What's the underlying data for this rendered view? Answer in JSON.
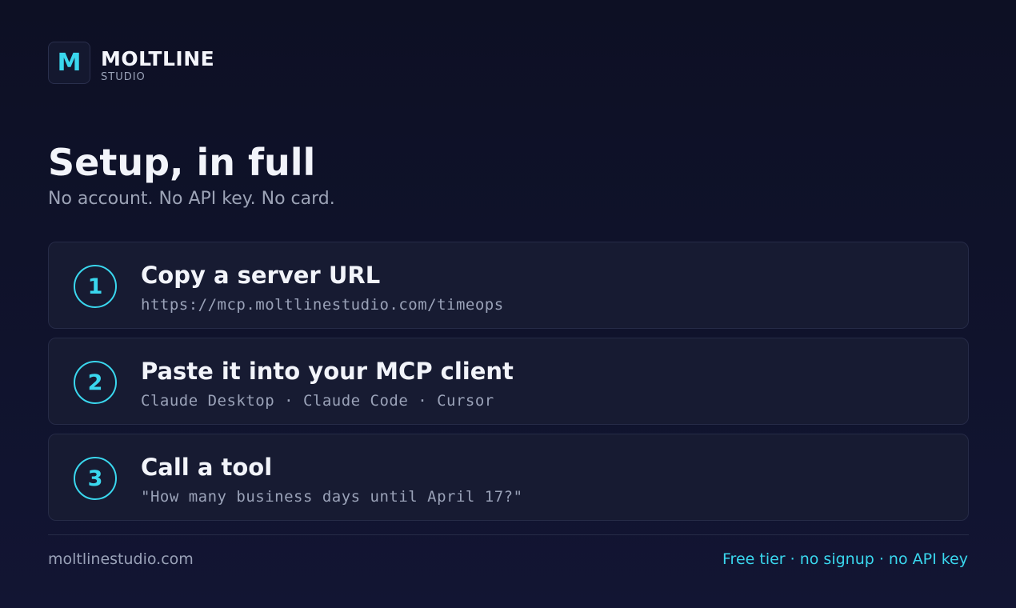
{
  "brand": {
    "logo_letter": "M",
    "name": "MOLTLINE",
    "sub": "STUDIO"
  },
  "heading": {
    "title": "Setup, in full",
    "subtitle": "No account. No API key. No card."
  },
  "steps": [
    {
      "number": "1",
      "title": "Copy a server URL",
      "detail": "https://mcp.moltlinestudio.com/timeops"
    },
    {
      "number": "2",
      "title": "Paste it into your MCP client",
      "detail": "Claude Desktop · Claude Code · Cursor"
    },
    {
      "number": "3",
      "title": "Call a tool",
      "detail": "\"How many business days until April 17?\""
    }
  ],
  "footer": {
    "site": "moltlinestudio.com",
    "tagline": "Free tier · no signup · no API key"
  },
  "colors": {
    "accent": "#3ad7ee",
    "background": "#0d1024",
    "card": "#171b32",
    "muted_text": "#9aa2b8"
  }
}
